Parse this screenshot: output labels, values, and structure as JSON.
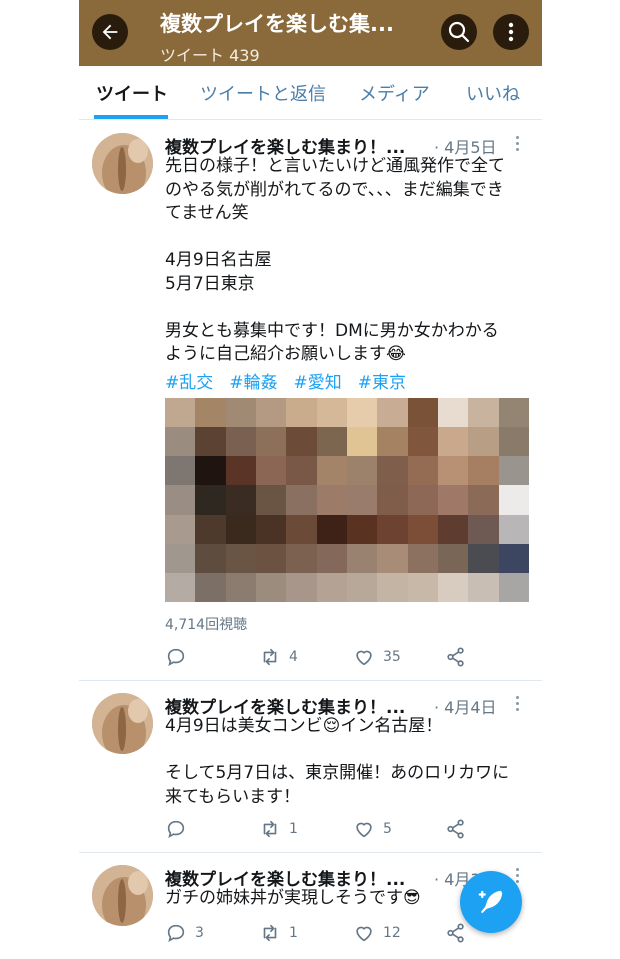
{
  "header": {
    "title": "複数プレイを楽しむ集...",
    "subtitle": "ツイート 439",
    "back_icon": "arrow-left-icon",
    "search_icon": "search-icon",
    "more_icon": "more-vertical-icon"
  },
  "tabs": [
    {
      "label": "ツイート",
      "active": true
    },
    {
      "label": "ツイートと返信",
      "active": false
    },
    {
      "label": "メディア",
      "active": false
    },
    {
      "label": "いいね",
      "active": false
    }
  ],
  "tweets": [
    {
      "name": "複数プレイを楽しむ集まり！...",
      "date": "· 4月5日",
      "text": "先日の様子！と言いたいけど通風発作で全て\nのやる気が削がれてるので、、、まだ編集でき\nてません笑\n\n4月9日名古屋\n5月7日東京\n\n男女とも募集中です！DMに男か女かわかる\nように自己紹介お願いします😂",
      "hashtags": [
        "#乱交",
        "#輪姦",
        "#愛知",
        "#東京"
      ],
      "views": "4,714回視聴",
      "reply_count": "",
      "retweet_count": "4",
      "like_count": "35"
    },
    {
      "name": "複数プレイを楽しむ集まり！...",
      "date": "· 4月4日",
      "text": "4月9日は美女コンビ😌イン名古屋！\n\nそして5月7日は、東京開催！あのロリカワに\n来てもらいます！",
      "reply_count": "",
      "retweet_count": "1",
      "like_count": "5"
    },
    {
      "name": "複数プレイを楽しむ集まり！...",
      "date": "· 4月3日",
      "text": "ガチの姉妹丼が実現しそうです😎",
      "reply_count": "3",
      "retweet_count": "1",
      "like_count": "12"
    }
  ],
  "fab": {
    "icon": "compose-feather-icon"
  },
  "colors": {
    "header_bg": "#8a6a3a",
    "accent": "#1da1f2",
    "muted": "#657786"
  },
  "media_pixels": [
    "#c0a890",
    "#a48666",
    "#a08a74",
    "#b49a82",
    "#c8ac8c",
    "#d4b898",
    "#e6ccaa",
    "#c8ac94",
    "#7a5238",
    "#e8dcd0",
    "#c8b49e",
    "#948472",
    "#9a8c7e",
    "#5c4232",
    "#7a6050",
    "#8c705a",
    "#6c4c38",
    "#7c6650",
    "#e0c494",
    "#a48262",
    "#80563c",
    "#caa88c",
    "#b89e84",
    "#8a7a6a",
    "#7e7670",
    "#201410",
    "#5a3426",
    "#8c6654",
    "#7a5848",
    "#a48468",
    "#9c826a",
    "#805e4c",
    "#946c54",
    "#b89074",
    "#a67e62",
    "#9a948e",
    "#9a8e84",
    "#2e2820",
    "#3a2c22",
    "#6a5444",
    "#8a7060",
    "#9c7c68",
    "#9a7c6c",
    "#805c4a",
    "#8e6856",
    "#a07868",
    "#8c6a58",
    "#ecebea",
    "#a89a8e",
    "#4e3a2c",
    "#3a2a1e",
    "#4a3224",
    "#6c4a38",
    "#3e2218",
    "#5a3222",
    "#6e4230",
    "#7c4e38",
    "#5e3c30",
    "#6e5a52",
    "#b8b6b6",
    "#a0988e",
    "#5e4c3e",
    "#6a5444",
    "#6c5240",
    "#7c6050",
    "#84685a",
    "#9a8270",
    "#a88c78",
    "#8c7060",
    "#7a6656",
    "#4a4c52",
    "#3c4660",
    "#b4aca4",
    "#7c7066",
    "#8c7c70",
    "#9c8c7e",
    "#a8968a",
    "#b4a294",
    "#b8a89a",
    "#c4b4a4",
    "#c8b8a8",
    "#d8ccc0",
    "#c8beb4",
    "#a8a6a4"
  ]
}
